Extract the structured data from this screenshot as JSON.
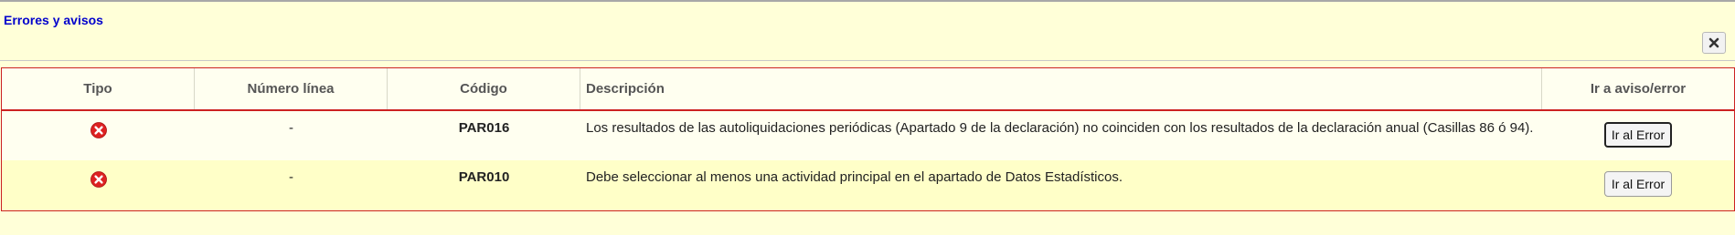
{
  "panel": {
    "title": "Errores y avisos",
    "close_icon": "close-x-icon"
  },
  "table": {
    "columns": [
      "Tipo",
      "Número línea",
      "Código",
      "Descripción",
      "Ir a aviso/error"
    ],
    "rows": [
      {
        "type_icon": "error-icon",
        "line_number": "-",
        "code": "PAR016",
        "description": "Los resultados de las autoliquidaciones periódicas (Apartado 9 de la declaración) no coinciden con los resultados de la declaración anual (Casillas 86 ó 94).",
        "action_label": "Ir al Error"
      },
      {
        "type_icon": "error-icon",
        "line_number": "-",
        "code": "PAR010",
        "description": "Debe seleccionar al menos una actividad principal en el apartado de Datos Estadísticos.",
        "action_label": "Ir al Error"
      }
    ]
  },
  "colors": {
    "error_red": "#dd2222",
    "border_red": "#cc2222",
    "title_blue": "#0000cc",
    "background": "#ffffd8"
  }
}
